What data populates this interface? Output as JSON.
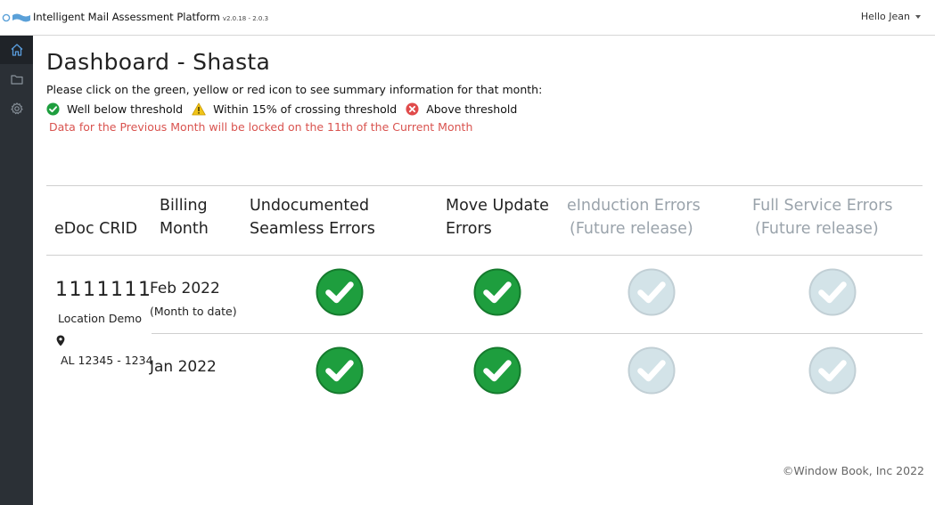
{
  "header": {
    "app_title": "Intelligent Mail Assessment Platform",
    "version": "v2.0.18 - 2.0.3",
    "user_greeting": "Hello Jean"
  },
  "sidebar": {
    "items": [
      {
        "name": "home",
        "icon": "home-icon",
        "active": true
      },
      {
        "name": "folder",
        "icon": "folder-icon",
        "active": false
      },
      {
        "name": "settings",
        "icon": "gear-icon",
        "active": false
      }
    ]
  },
  "page": {
    "title": "Dashboard - Shasta",
    "instructions": "Please click on the green, yellow or red icon to see summary information for that month:",
    "legend": {
      "green": "Well below threshold",
      "yellow": "Within 15% of crossing threshold",
      "red": "Above threshold"
    },
    "lock_note": "Data for the Previous Month will be locked on the 11th of the Current Month"
  },
  "table": {
    "headers": {
      "crid": "eDoc CRID",
      "billing_1": "Billing",
      "billing_2": "Month",
      "undoc_1": "Undocumented",
      "undoc_2": "Seamless Errors",
      "move_1": "Move Update",
      "move_2": "Errors",
      "einduction_1": "eInduction Errors",
      "einduction_2": "(Future release)",
      "fullservice_1": "Full Service Errors",
      "fullservice_2": "(Future release)"
    },
    "crid": "1111111",
    "location_name": "Location Demo",
    "location_address": "AL 12345 - 1234",
    "rows": [
      {
        "month": "Feb 2022",
        "month_note": "(Month to date)",
        "undocumented": "green",
        "move_update": "green",
        "einduction": "disabled",
        "full_service": "disabled"
      },
      {
        "month": "Jan 2022",
        "month_note": "",
        "undocumented": "green",
        "move_update": "green",
        "einduction": "disabled",
        "full_service": "disabled"
      }
    ]
  },
  "footer": {
    "copyright": "©Window Book, Inc 2022"
  },
  "colors": {
    "status_green": "#1e9e3e",
    "status_green_border": "#157a2d",
    "status_disabled": "#d3e3e8",
    "status_disabled_border": "#c1cfd5",
    "warning_yellow": "#f0c419",
    "danger_red": "#e04b4b",
    "lock_note": "#d9534f",
    "sidebar": "#2b3036"
  }
}
